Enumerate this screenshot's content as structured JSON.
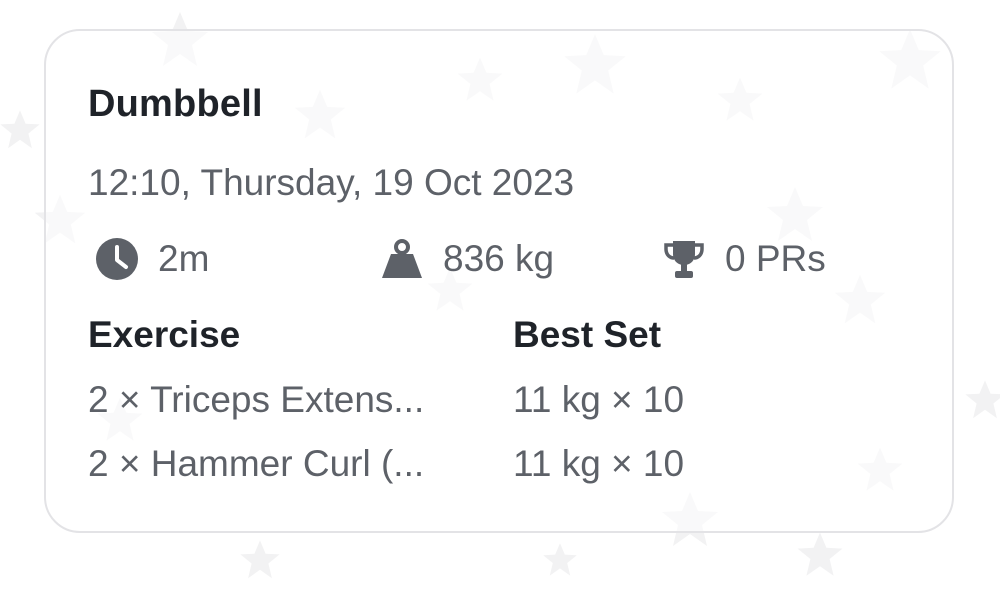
{
  "card": {
    "title": "Dumbbell",
    "datetime": "12:10, Thursday, 19 Oct 2023",
    "stats": {
      "duration": {
        "icon": "clock-icon",
        "value": "2m"
      },
      "volume": {
        "icon": "weight-icon",
        "value": "836 kg"
      },
      "prs": {
        "icon": "trophy-icon",
        "value": "0 PRs"
      }
    },
    "table": {
      "headers": {
        "exercise": "Exercise",
        "best_set": "Best Set"
      },
      "rows": [
        {
          "exercise": "2 × Triceps Extens...",
          "best_set": "11 kg × 10"
        },
        {
          "exercise": "2 × Hammer Curl (...",
          "best_set": "11 kg × 10"
        }
      ]
    }
  },
  "colors": {
    "title": "#1f2329",
    "secondary_text": "#5d6168",
    "icon": "#5d6168",
    "card_border": "#e3e3e6",
    "background": "#ffffff"
  }
}
